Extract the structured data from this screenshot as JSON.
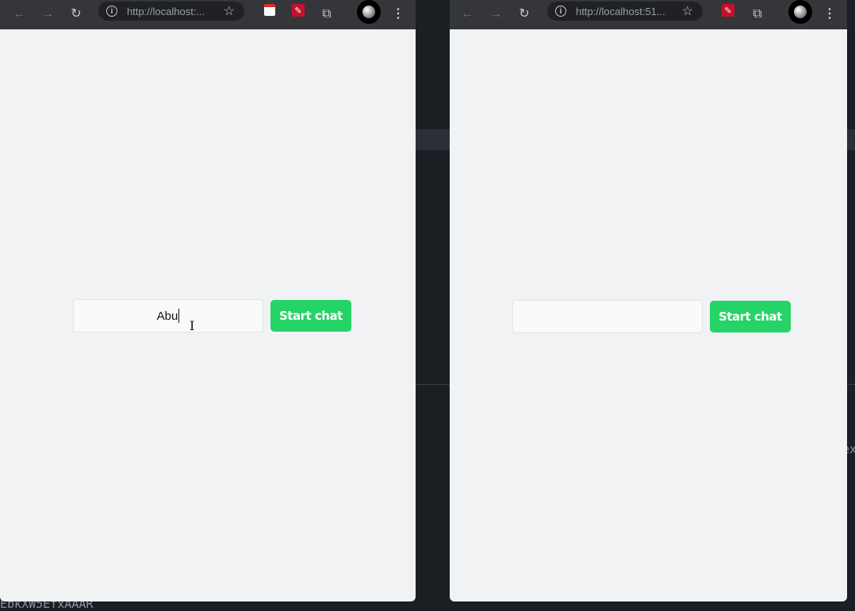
{
  "background": {
    "editor_fragment_right": "ex",
    "editor_fragment_bottom": "EbkXW5EfxAAAR"
  },
  "windows": [
    {
      "url": "http://localhost:...",
      "input_value": "Abu",
      "input_placeholder": "",
      "button_label": "Start chat",
      "focused": true
    },
    {
      "url": "http://localhost:51...",
      "input_value": "",
      "input_placeholder": "",
      "button_label": "Start chat",
      "focused": false
    }
  ],
  "icons": {
    "back": "arrow-left-icon",
    "forward": "arrow-right-icon",
    "reload": "reload-icon",
    "info": "info-icon",
    "bookmark": "star-icon",
    "extensions": "puzzle-icon",
    "menu": "kebab-icon"
  },
  "colors": {
    "accent": "#25d366",
    "toolbar": "#35363a",
    "page": "#f1f2f4"
  }
}
